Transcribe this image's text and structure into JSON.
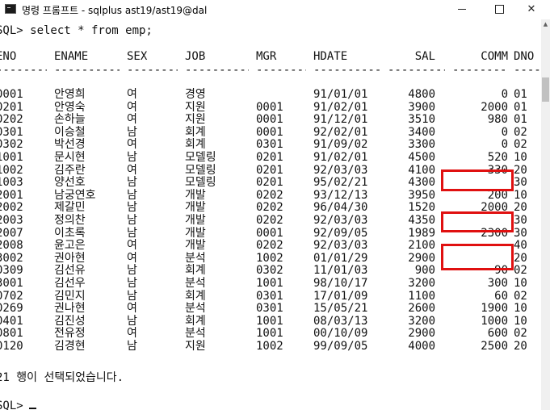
{
  "window": {
    "title": "명령 프롬프트 - sqlplus  ast19/ast19@dal",
    "minimize_label": "",
    "maximize_label": "",
    "close_label": "✕"
  },
  "console": {
    "command_line": "SQL> select * from emp;",
    "headers": [
      "ENO",
      "ENAME",
      "SEX",
      "JOB",
      "MGR",
      "HDATE",
      "SAL",
      "COMM",
      "DNO"
    ],
    "rows": [
      [
        "0001",
        "안영희",
        "여",
        "경영",
        "",
        "91/01/01",
        "4800",
        "0",
        "01"
      ],
      [
        "0201",
        "안영숙",
        "여",
        "지원",
        "0001",
        "91/02/01",
        "3900",
        "2000",
        "01"
      ],
      [
        "0202",
        "손하늘",
        "여",
        "지원",
        "0001",
        "91/12/01",
        "3510",
        "980",
        "01"
      ],
      [
        "0301",
        "이승철",
        "남",
        "회계",
        "0001",
        "92/02/01",
        "3400",
        "0",
        "02"
      ],
      [
        "0302",
        "박선경",
        "여",
        "회계",
        "0301",
        "91/09/02",
        "3300",
        "0",
        "02"
      ],
      [
        "1001",
        "문시현",
        "남",
        "모델링",
        "0201",
        "91/02/01",
        "4500",
        "520",
        "10"
      ],
      [
        "1002",
        "김주란",
        "여",
        "모델링",
        "0201",
        "92/03/03",
        "4100",
        "330",
        "20"
      ],
      [
        "1003",
        "양선호",
        "남",
        "모델링",
        "0201",
        "95/02/21",
        "4300",
        "",
        "30"
      ],
      [
        "2001",
        "남궁연호",
        "남",
        "개발",
        "0202",
        "93/12/13",
        "3950",
        "200",
        "10"
      ],
      [
        "2002",
        "제갈민",
        "남",
        "개발",
        "0202",
        "96/04/30",
        "1520",
        "2000",
        "20"
      ],
      [
        "2003",
        "정의찬",
        "남",
        "개발",
        "0202",
        "92/03/03",
        "4350",
        "",
        "30"
      ],
      [
        "2007",
        "이초록",
        "남",
        "개발",
        "0001",
        "92/09/05",
        "1989",
        "2300",
        "30"
      ],
      [
        "2008",
        "윤고은",
        "여",
        "개발",
        "0202",
        "92/03/03",
        "2100",
        "",
        "40"
      ],
      [
        "3002",
        "권아현",
        "여",
        "분석",
        "1002",
        "01/01/29",
        "2900",
        "",
        "20"
      ],
      [
        "0309",
        "김선유",
        "남",
        "회계",
        "0302",
        "11/01/03",
        "900",
        "90",
        "02"
      ],
      [
        "3001",
        "김선우",
        "남",
        "분석",
        "1001",
        "98/10/17",
        "3200",
        "300",
        "10"
      ],
      [
        "0702",
        "김민지",
        "남",
        "회계",
        "0301",
        "17/01/09",
        "1100",
        "60",
        "02"
      ],
      [
        "0269",
        "권나현",
        "여",
        "분석",
        "0301",
        "15/05/21",
        "2600",
        "1900",
        "10"
      ],
      [
        "0401",
        "김진성",
        "남",
        "회계",
        "1001",
        "08/03/13",
        "3200",
        "1000",
        "10"
      ],
      [
        "0801",
        "전유정",
        "여",
        "분석",
        "1001",
        "00/10/09",
        "2900",
        "600",
        "02"
      ],
      [
        "0120",
        "김경현",
        "남",
        "지원",
        "1002",
        "99/09/05",
        "4000",
        "2500",
        "20"
      ]
    ],
    "result_message": "21 행이 선택되었습니다.",
    "prompt": "SQL> "
  },
  "annotations": {
    "box_color": "#e01010"
  }
}
